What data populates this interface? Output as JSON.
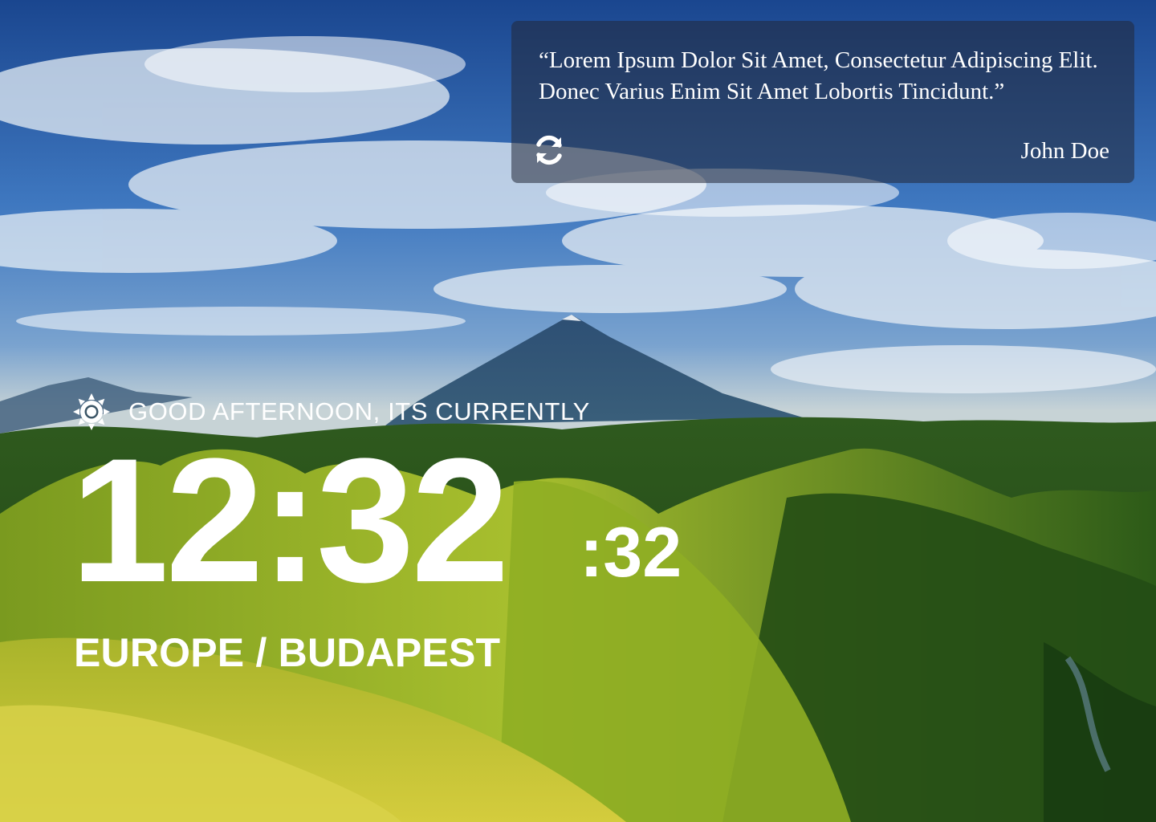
{
  "background": {
    "sky_top": "#1d4d99",
    "sky_mid": "#3a78c4",
    "horizon": "#c9d6d8",
    "mountain": "#2b4c70",
    "hill_dark": "#1f4a14",
    "hill_light": "#9fb82b",
    "grass": "#c9c734"
  },
  "quote": {
    "text": "“Lorem Ipsum Dolor Sit Amet, Consectetur Adipiscing Elit. Donec Varius Enim Sit Amet Lobortis Tincidunt.”",
    "author": "John Doe",
    "refresh_icon": "refresh-icon"
  },
  "clock": {
    "weather_icon": "sun-icon",
    "greeting": "GOOD AFTERNOON, ITS CURRENTLY",
    "time": "12:32",
    "seconds": ":32",
    "location": "EUROPE / BUDAPEST"
  }
}
